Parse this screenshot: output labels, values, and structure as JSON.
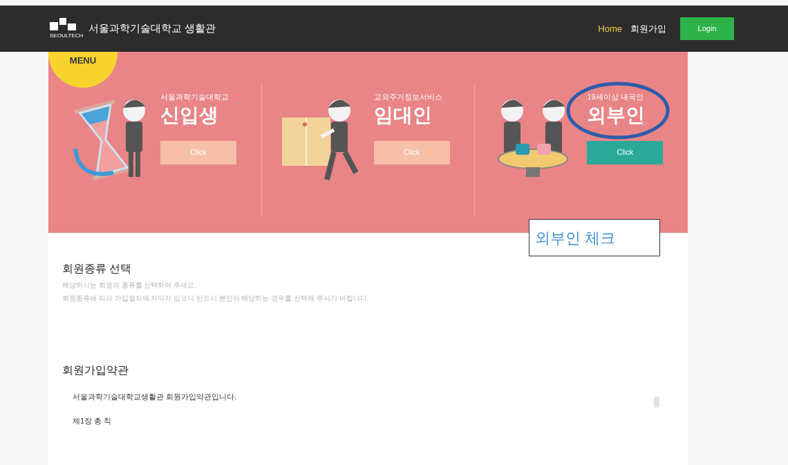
{
  "header": {
    "logo_title": "서울과학기술대학교 생활관",
    "logo_caption": "SEOULTECH",
    "nav": [
      {
        "label": "Home",
        "selected": true
      },
      {
        "label": "회원가입",
        "selected": false
      }
    ],
    "login_button": "Login"
  },
  "menu_badge": "MENU",
  "cards": [
    {
      "kind": "hourglass",
      "subtitle": "서울과학기술대학교",
      "title": "신입생",
      "button": "Click",
      "selected": false,
      "circled": false
    },
    {
      "kind": "box",
      "subtitle": "교외주거정보서비스",
      "title": "임대인",
      "button": "Click",
      "selected": false,
      "circled": false
    },
    {
      "kind": "table",
      "subtitle": "19세이상 내국인",
      "title": "외부인",
      "button": "Click",
      "selected": true,
      "circled": true
    }
  ],
  "annotation_note": "외부인 체크",
  "member_type": {
    "heading": "회원종류 선택",
    "lines": [
      "해당하시는 회원의 종류를 선택하여 주세요.",
      "회원종류에 따라 가입절차에 차이가 있으니 반드시 본인이 해당하는 경우를 선택해 주시기 바랍니다."
    ]
  },
  "terms": {
    "heading": "회원가입약관",
    "lines": [
      "서울과학기술대학교생활관 회원가입약관입니다.",
      "제1장 총 칙"
    ]
  }
}
